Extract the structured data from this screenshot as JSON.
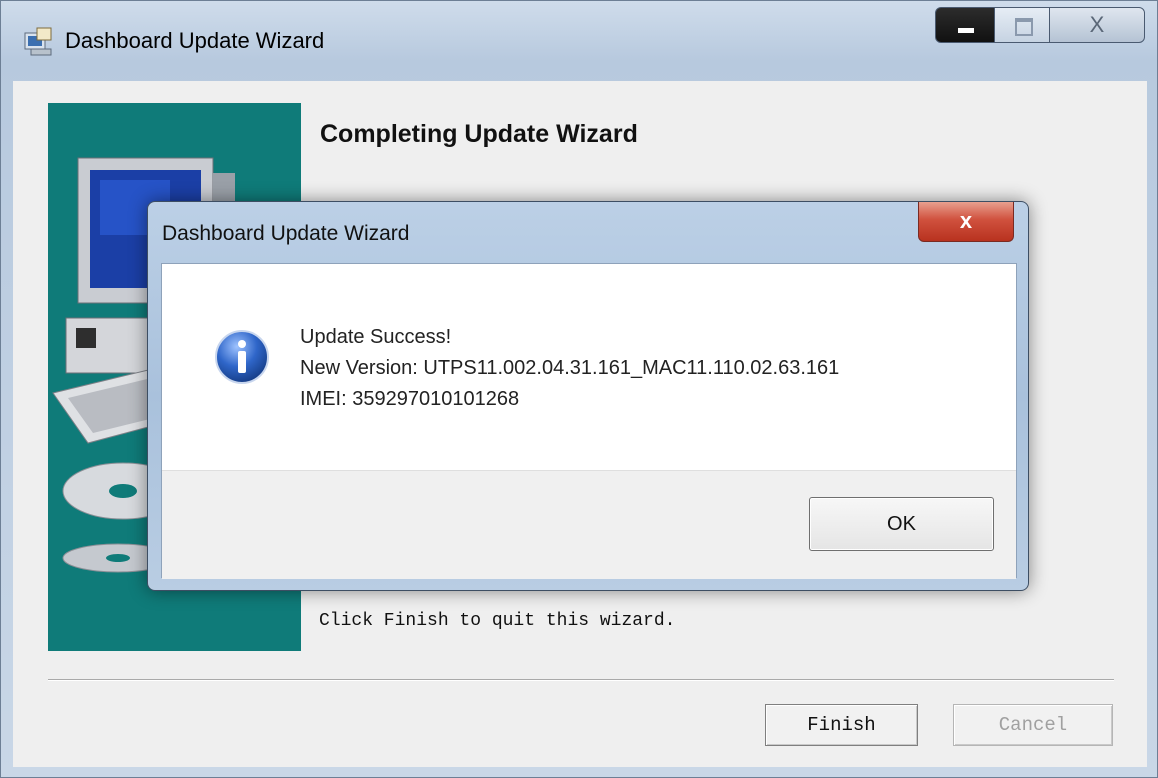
{
  "window": {
    "title": "Dashboard Update Wizard",
    "close_glyph": "X"
  },
  "wizard": {
    "heading": "Completing Update Wizard",
    "finish_text": "Click Finish to quit this wizard.",
    "finish_label": "Finish",
    "cancel_label": "Cancel"
  },
  "dialog": {
    "title": "Dashboard Update Wizard",
    "close_glyph": "x",
    "line1": "Update Success!",
    "line2": "New Version: UTPS11.002.04.31.161_MAC11.110.02.63.161",
    "line3": "IMEI: 359297010101268",
    "ok_label": "OK",
    "icon": "info-icon"
  },
  "colors": {
    "sidebar": "#0f7b79",
    "dialog_close": "#c9412d"
  }
}
